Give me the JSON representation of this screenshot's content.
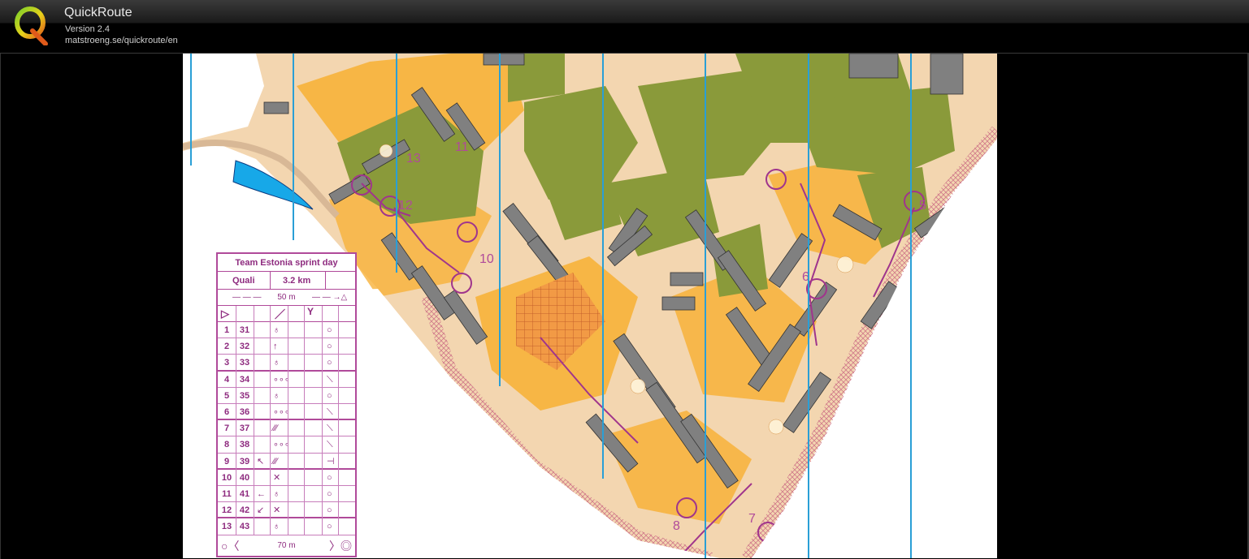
{
  "app": {
    "title": "QuickRoute",
    "version": "Version 2.4",
    "url": "matstroeng.se/quickroute/en"
  },
  "colors": {
    "titlebar": "#1a1a1a",
    "background": "#000000",
    "legend_purple": "#8e2b7f",
    "map_green": "#8a9a3a",
    "map_orange": "#f7b23a",
    "map_beige": "#f3d9b8",
    "map_grey": "#7f7f7f",
    "grid_blue": "#2a9fd6"
  },
  "map": {
    "control_numbers": [
      "13",
      "11",
      "12",
      "10",
      "6",
      "5",
      "8",
      "7"
    ],
    "legend": {
      "title": "Team Estonia sprint day",
      "class": "Quali",
      "length": "3.2 km",
      "start_scale": "50 m",
      "finish_scale": "70 m",
      "controls": [
        {
          "num": "1",
          "code": "31"
        },
        {
          "num": "2",
          "code": "32"
        },
        {
          "num": "3",
          "code": "33"
        },
        {
          "num": "4",
          "code": "34"
        },
        {
          "num": "5",
          "code": "35"
        },
        {
          "num": "6",
          "code": "36"
        },
        {
          "num": "7",
          "code": "37"
        },
        {
          "num": "8",
          "code": "38"
        },
        {
          "num": "9",
          "code": "39"
        },
        {
          "num": "10",
          "code": "40"
        },
        {
          "num": "11",
          "code": "41"
        },
        {
          "num": "12",
          "code": "42"
        },
        {
          "num": "13",
          "code": "43"
        }
      ]
    }
  }
}
